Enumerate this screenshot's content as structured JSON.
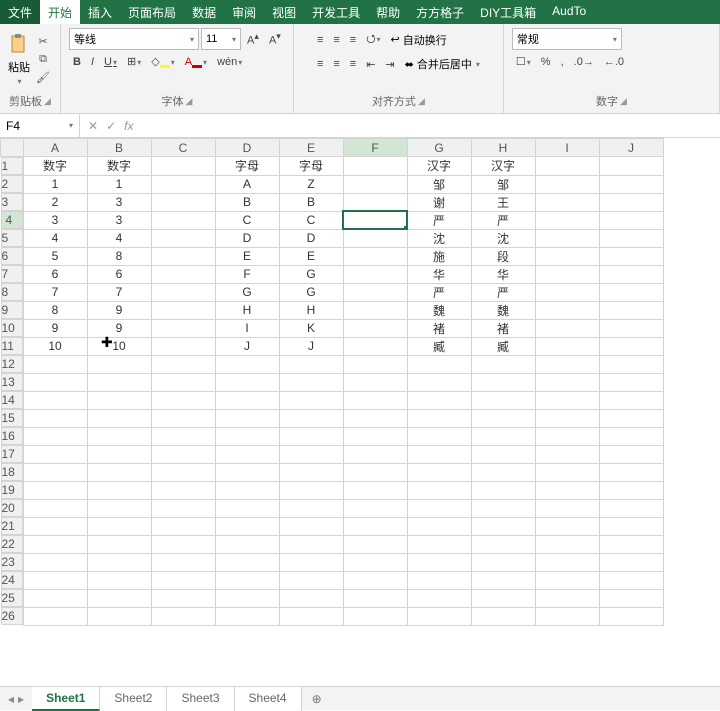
{
  "tabs": {
    "file": "文件",
    "home": "开始",
    "insert": "插入",
    "layout": "页面布局",
    "data": "数据",
    "review": "审阅",
    "view": "视图",
    "dev": "开发工具",
    "help": "帮助",
    "sq": "方方格子",
    "diy": "DIY工具箱",
    "aud": "AudTo"
  },
  "ribbon": {
    "clipboard": {
      "paste": "粘贴",
      "label": "剪贴板"
    },
    "font": {
      "name": "等线",
      "size": "11",
      "bold": "B",
      "italic": "I",
      "underline": "U",
      "label": "字体",
      "wen": "wén"
    },
    "align": {
      "wrap": "自动换行",
      "merge": "合并后居中",
      "label": "对齐方式"
    },
    "number": {
      "format": "常规",
      "percent": "%",
      "comma": ",",
      "label": "数字"
    }
  },
  "namebox": "F4",
  "fx_label": "fx",
  "sheets": {
    "items": [
      "Sheet1",
      "Sheet2",
      "Sheet3",
      "Sheet4"
    ],
    "active": 0,
    "add": "+"
  },
  "columns": [
    "A",
    "B",
    "C",
    "D",
    "E",
    "F",
    "G",
    "H",
    "I",
    "J"
  ],
  "rowcount": 26,
  "active_cell": {
    "row": 4,
    "col": "F"
  },
  "chart_data": {
    "type": "table",
    "headers": {
      "A": "数字",
      "B": "数字",
      "D": "字母",
      "E": "字母",
      "G": "汉字",
      "H": "汉字"
    },
    "rows": [
      {
        "A": "1",
        "B": "1",
        "D": "A",
        "E": "Z",
        "G": "邹",
        "H": "邹"
      },
      {
        "A": "2",
        "B": "3",
        "D": "B",
        "E": "B",
        "G": "谢",
        "H": "王"
      },
      {
        "A": "3",
        "B": "3",
        "D": "C",
        "E": "C",
        "G": "严",
        "H": "严"
      },
      {
        "A": "4",
        "B": "4",
        "D": "D",
        "E": "D",
        "G": "沈",
        "H": "沈"
      },
      {
        "A": "5",
        "B": "8",
        "D": "E",
        "E": "E",
        "G": "施",
        "H": "段"
      },
      {
        "A": "6",
        "B": "6",
        "D": "F",
        "E": "G",
        "G": "华",
        "H": "华"
      },
      {
        "A": "7",
        "B": "7",
        "D": "G",
        "E": "G",
        "G": "严",
        "H": "严"
      },
      {
        "A": "8",
        "B": "9",
        "D": "H",
        "E": "H",
        "G": "魏",
        "H": "魏"
      },
      {
        "A": "9",
        "B": "9",
        "D": "I",
        "E": "K",
        "G": "褚",
        "H": "褚"
      },
      {
        "A": "10",
        "B": "10",
        "D": "J",
        "E": "J",
        "G": "臧",
        "H": "臧"
      }
    ]
  }
}
